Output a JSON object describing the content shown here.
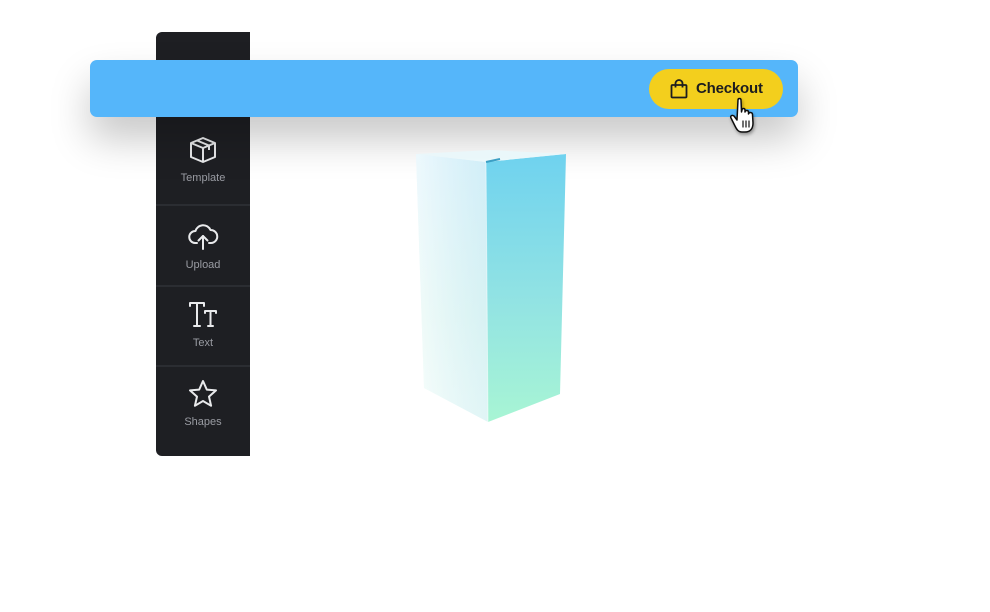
{
  "sidebar": {
    "items": [
      {
        "label": "Template",
        "icon": "package-icon"
      },
      {
        "label": "Upload",
        "icon": "cloud-upload-icon"
      },
      {
        "label": "Text",
        "icon": "text-icon"
      },
      {
        "label": "Shapes",
        "icon": "star-icon"
      }
    ]
  },
  "topbar": {
    "checkout_label": "Checkout",
    "checkout_icon": "shopping-bag-icon"
  },
  "colors": {
    "topbar": "#55b6fa",
    "checkout": "#f3cf1d",
    "sidebar": "#1e1f23",
    "box_gradient_top": "#72d4f0",
    "box_gradient_bottom": "#a6f5d6"
  }
}
